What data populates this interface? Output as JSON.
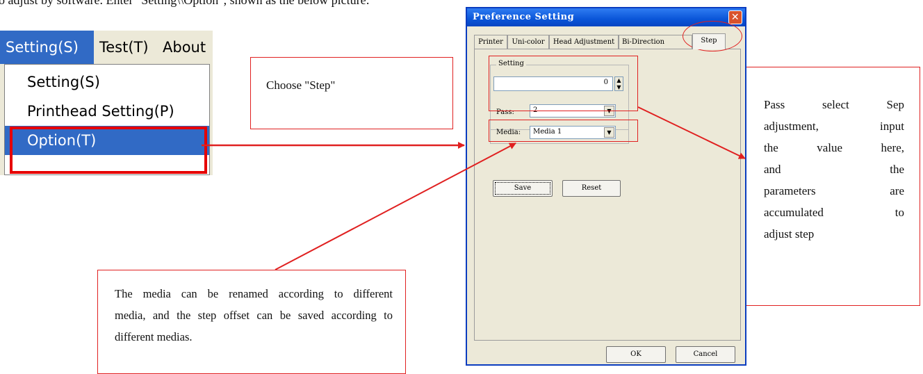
{
  "caption_top": "o adjust by software. Enter \"Setting\\\\Option\", shown as the below picture:",
  "menu": {
    "bar": [
      "Setting(S)",
      "Test(T)",
      "About"
    ],
    "items": [
      "Setting(S)",
      "Printhead Setting(P)",
      "Option(T)"
    ],
    "selected_item": "Option(T)"
  },
  "callouts": {
    "choose_step": "Choose \"Step\"",
    "pass_note": [
      "Pass select Sep",
      "adjustment, input",
      "the value here,",
      "and the",
      "parameters are",
      "accumulated to",
      "adjust step"
    ],
    "media_note": [
      "The media can be renamed according to different",
      "media, and the step offset can be saved according to",
      "different medias."
    ]
  },
  "dialog": {
    "title": "Preference Setting",
    "close_glyph": "✕",
    "tabs": [
      "Printer",
      "Uni-color",
      "Head Adjustment",
      "Bi-Direction",
      "Step"
    ],
    "active_tab": "Step",
    "setting_group_label": "Setting",
    "step_value": "0",
    "pass_label": "Pass:",
    "pass_value": "2",
    "media_label": "Media:",
    "media_value": "Media 1",
    "save_label": "Save",
    "reset_label": "Reset",
    "ok_label": "OK",
    "cancel_label": "Cancel",
    "spin_up": "▲",
    "spin_down": "▼",
    "combo_arrow": "▼"
  },
  "colors": {
    "highlight": "#316ac5",
    "annotation_red": "#e02020",
    "titlebar_blue": "#0a55d8",
    "dialog_face": "#ece9d8"
  }
}
